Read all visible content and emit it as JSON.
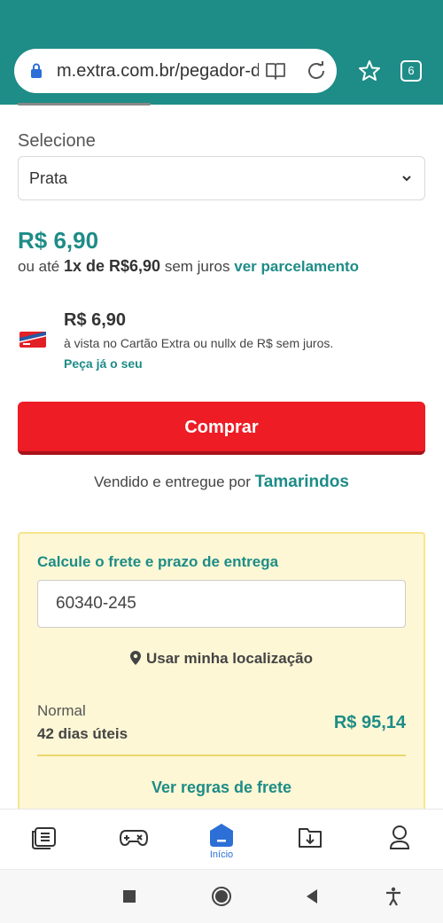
{
  "browser": {
    "url": "m.extra.com.br/pegador-d",
    "tab_count": "6",
    "accent": "#1e8c87"
  },
  "product": {
    "variant_label": "Selecione",
    "variant_value": "Prata",
    "price": "R$ 6,90",
    "installment_prefix": "ou até",
    "installment_bold": "1x de R$6,90",
    "installment_suffix": "sem juros",
    "installment_link": "ver parcelamento"
  },
  "card_offer": {
    "price": "R$ 6,90",
    "description": "à vista no Cartão Extra ou nullx de R$ sem juros.",
    "link": "Peça já o seu"
  },
  "buy": {
    "label": "Comprar",
    "color": "#ee1c25"
  },
  "seller": {
    "prefix": "Vendido e entregue por",
    "name": "Tamarindos"
  },
  "shipping": {
    "title": "Calcule o frete e prazo de entrega",
    "cep": "60340-245",
    "use_location": "Usar minha localização",
    "method": "Normal",
    "days": "42 dias úteis",
    "price": "R$ 95,14",
    "rules_link": "Ver regras de frete"
  },
  "bottom_nav": {
    "items": [
      {
        "icon": "catalog-icon"
      },
      {
        "icon": "gamepad-icon"
      },
      {
        "icon": "home-icon",
        "label": "Início"
      },
      {
        "icon": "download-box-icon"
      },
      {
        "icon": "profile-icon"
      }
    ]
  },
  "system_nav": [
    "recents-icon",
    "home-circle-icon",
    "back-icon",
    "accessibility-icon"
  ]
}
